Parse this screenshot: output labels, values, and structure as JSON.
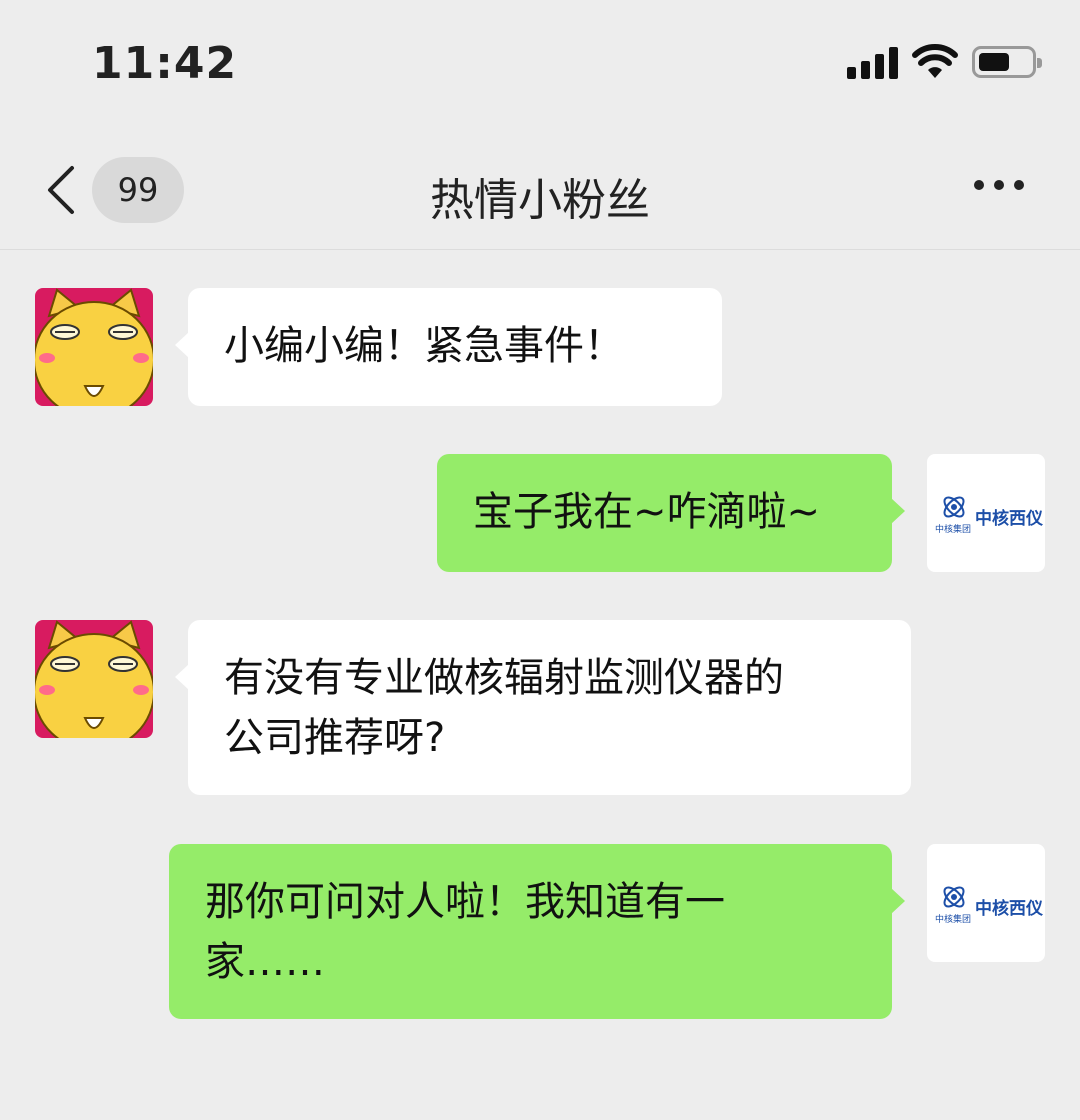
{
  "status_bar": {
    "time": "11:42"
  },
  "nav": {
    "unread_count": "99",
    "title": "热情小粉丝"
  },
  "messages": [
    {
      "side": "in",
      "text": "小编小编！紧急事件！"
    },
    {
      "side": "out",
      "text": "宝子我在~咋滴啦~"
    },
    {
      "side": "in",
      "lines": [
        "有没有专业做核辐射监测仪器的",
        "公司推荐呀?"
      ]
    },
    {
      "side": "out",
      "lines": [
        "那你可问对人啦！我知道有一",
        "家……"
      ]
    }
  ],
  "logo": {
    "name": "中核西仪",
    "sub": "中核集团"
  },
  "colors": {
    "background": "#ededed",
    "incoming": "#ffffff",
    "outgoing": "#95ec69",
    "logo_blue": "#1d4fa8"
  },
  "icons": [
    "signal-icon",
    "wifi-icon",
    "battery-icon",
    "back-chevron-icon",
    "more-icon",
    "cat-avatar-icon",
    "company-logo-icon"
  ]
}
